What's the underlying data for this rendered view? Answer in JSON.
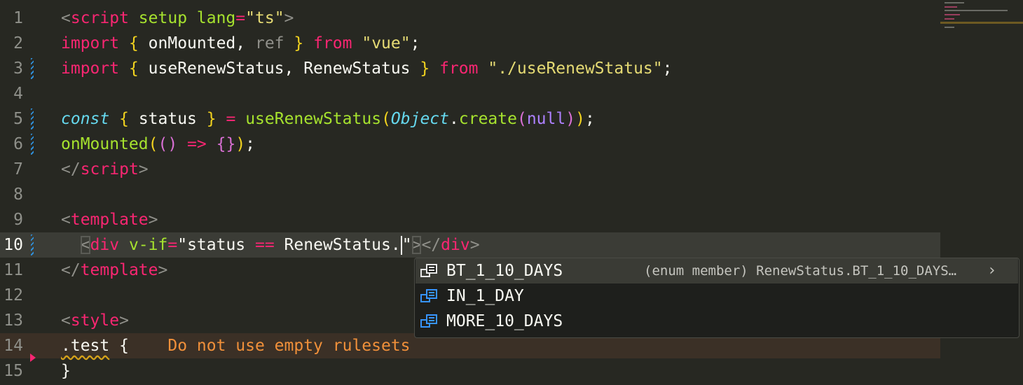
{
  "editor": {
    "lines": [
      {
        "num": "1",
        "tokens": [
          [
            "d",
            "<"
          ],
          [
            "k",
            "script"
          ],
          [
            "f",
            " setup"
          ],
          [
            "f",
            " lang"
          ],
          [
            "k",
            "="
          ],
          [
            "s",
            "\"ts\""
          ],
          [
            "d",
            ">"
          ]
        ]
      },
      {
        "num": "2",
        "tokens": [
          [
            "k",
            "import"
          ],
          [
            "p",
            " "
          ],
          [
            "y",
            "{"
          ],
          [
            "p",
            " onMounted, "
          ],
          [
            "d",
            "ref"
          ],
          [
            "p",
            " "
          ],
          [
            "y",
            "}"
          ],
          [
            "p",
            " "
          ],
          [
            "k",
            "from"
          ],
          [
            "p",
            " "
          ],
          [
            "s",
            "\"vue\""
          ],
          [
            "p",
            ";"
          ]
        ]
      },
      {
        "num": "3",
        "tokens": [
          [
            "k",
            "import"
          ],
          [
            "p",
            " "
          ],
          [
            "y",
            "{"
          ],
          [
            "p",
            " useRenewStatus, RenewStatus "
          ],
          [
            "y",
            "}"
          ],
          [
            "p",
            " "
          ],
          [
            "k",
            "from"
          ],
          [
            "p",
            " "
          ],
          [
            "s",
            "\"./useRenewStatus\""
          ],
          [
            "p",
            ";"
          ]
        ]
      },
      {
        "num": "4",
        "tokens": []
      },
      {
        "num": "5",
        "tokens": [
          [
            "c",
            "const"
          ],
          [
            "p",
            " "
          ],
          [
            "y",
            "{"
          ],
          [
            "p",
            " status "
          ],
          [
            "y",
            "}"
          ],
          [
            "p",
            " "
          ],
          [
            "k",
            "="
          ],
          [
            "p",
            " "
          ],
          [
            "f",
            "useRenewStatus"
          ],
          [
            "y",
            "("
          ],
          [
            "c",
            "Object"
          ],
          [
            "p",
            "."
          ],
          [
            "f",
            "create"
          ],
          [
            "pp",
            "("
          ],
          [
            "n",
            "null"
          ],
          [
            "pp",
            ")"
          ],
          [
            "y",
            ")"
          ],
          [
            "p",
            ";"
          ]
        ]
      },
      {
        "num": "6",
        "tokens": [
          [
            "f",
            "onMounted"
          ],
          [
            "y",
            "("
          ],
          [
            "pp",
            "()"
          ],
          [
            "p",
            " "
          ],
          [
            "k",
            "=>"
          ],
          [
            "p",
            " "
          ],
          [
            "pp",
            "{}"
          ],
          [
            "y",
            ")"
          ],
          [
            "p",
            ";"
          ]
        ]
      },
      {
        "num": "7",
        "tokens": [
          [
            "d",
            "</"
          ],
          [
            "k",
            "script"
          ],
          [
            "d",
            ">"
          ]
        ]
      },
      {
        "num": "8",
        "tokens": []
      },
      {
        "num": "9",
        "tokens": [
          [
            "d",
            "<"
          ],
          [
            "k",
            "template"
          ],
          [
            "d",
            ">"
          ]
        ]
      },
      {
        "num": "10",
        "tokens": [
          [
            "p",
            "  "
          ],
          [
            "dbox",
            "<"
          ],
          [
            "k",
            "div"
          ],
          [
            "f",
            " v-if"
          ],
          [
            "k",
            "="
          ],
          [
            "p",
            "\"status "
          ],
          [
            "k",
            "=="
          ],
          [
            "p",
            " RenewStatus."
          ],
          [
            "caret",
            ""
          ],
          [
            "p",
            "\""
          ],
          [
            "dbox",
            ">"
          ],
          [
            "d",
            "</"
          ],
          [
            "k",
            "div"
          ],
          [
            "d",
            ">"
          ]
        ]
      },
      {
        "num": "11",
        "tokens": [
          [
            "d",
            "</"
          ],
          [
            "k",
            "template"
          ],
          [
            "d",
            ">"
          ]
        ]
      },
      {
        "num": "12",
        "tokens": []
      },
      {
        "num": "13",
        "tokens": [
          [
            "d",
            "<"
          ],
          [
            "k",
            "style"
          ],
          [
            "d",
            ">"
          ]
        ]
      },
      {
        "num": "14",
        "tokens": [
          [
            "sq",
            ".test"
          ],
          [
            "p",
            " {    "
          ],
          [
            "diag",
            "Do not use empty rulesets"
          ]
        ]
      },
      {
        "num": "15",
        "tokens": [
          [
            "p",
            "}"
          ]
        ]
      }
    ],
    "active_line": "10"
  },
  "suggest": {
    "items": [
      {
        "label": "BT_1_10_DAYS",
        "detail": "(enum member) RenewStatus.BT_1_10_DAYS…",
        "chevron": "›",
        "icon": "enum-member-icon"
      },
      {
        "label": "IN_1_DAY",
        "icon": "enum-member-icon"
      },
      {
        "label": "MORE_10_DAYS",
        "icon": "enum-member-icon"
      }
    ]
  },
  "colors": {
    "background": "#272822",
    "keyword": "#f92672",
    "string": "#e6db74",
    "function": "#a6e22e",
    "storage": "#66d9ef",
    "constant": "#ae81ff",
    "warning": "#f0903a",
    "icon_blue": "#3794ff"
  }
}
